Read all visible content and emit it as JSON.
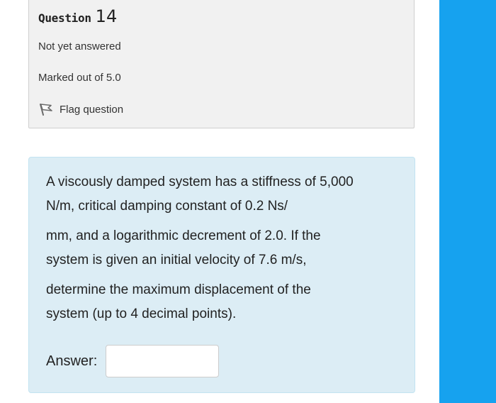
{
  "question": {
    "label_word": "Question",
    "number": "14",
    "state": "Not yet answered",
    "grade": "Marked out of 5.0",
    "flag_label": "Flag question"
  },
  "text": {
    "p1_line1": "A viscously damped system has a stiffness of 5,000",
    "p1_line2": "N/m, critical damping constant of 0.2 Ns/",
    "p2_line1": "mm, and a logarithmic decrement of 2.0. If the",
    "p2_line2": "system is given an initial velocity of  7.6 m/s,",
    "p3_line1": "determine the maximum displacement of the",
    "p3_line2": "system (up to 4 decimal points)."
  },
  "answer": {
    "label": "Answer:",
    "value": ""
  },
  "icons": {
    "flag": "flag-icon"
  },
  "colors": {
    "info_bg": "#f1f1f1",
    "formulation_bg": "#dcedf5",
    "right_strip": "#16a2ef"
  }
}
